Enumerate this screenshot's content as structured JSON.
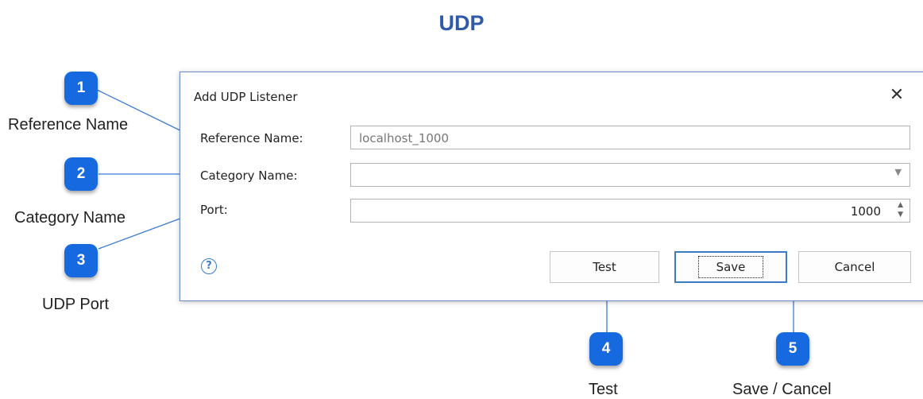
{
  "page": {
    "title": "UDP"
  },
  "dialog": {
    "title": "Add UDP Listener",
    "close_icon": "close-icon",
    "fields": {
      "reference_name": {
        "label": "Reference Name:",
        "value": "localhost_1000"
      },
      "category_name": {
        "label": "Category Name:",
        "value": ""
      },
      "port": {
        "label": "Port:",
        "value": "1000"
      }
    },
    "help_icon": "help-icon",
    "buttons": {
      "test": "Test",
      "save": "Save",
      "cancel": "Cancel"
    }
  },
  "callouts": [
    {
      "number": "1",
      "caption": "Reference Name"
    },
    {
      "number": "2",
      "caption": "Category Name"
    },
    {
      "number": "3",
      "caption": "UDP Port"
    },
    {
      "number": "4",
      "caption": "Test"
    },
    {
      "number": "5",
      "caption": "Save / Cancel"
    }
  ],
  "colors": {
    "accent": "#1769e0",
    "title": "#2e5aa8",
    "dialog_border": "#6a8ec4"
  }
}
